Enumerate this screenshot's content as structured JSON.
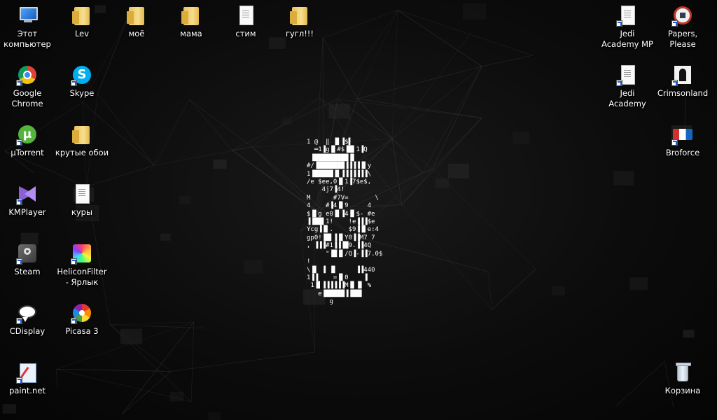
{
  "desktop": {
    "icons_left": [
      {
        "label": "Этот компьютер",
        "icon": "computer-icon"
      },
      {
        "label": "Google Chrome",
        "icon": "chrome-icon"
      },
      {
        "label": "µTorrent",
        "icon": "utorrent-icon"
      },
      {
        "label": "KMPlayer",
        "icon": "kmplayer-icon"
      },
      {
        "label": "Steam",
        "icon": "steam-icon"
      },
      {
        "label": "CDisplay",
        "icon": "cdisplay-icon"
      },
      {
        "label": "paint.net",
        "icon": "paintnet-icon"
      }
    ],
    "icons_col2": [
      {
        "label": "Lev",
        "icon": "user-folder-icon"
      },
      {
        "label": "Skype",
        "icon": "skype-icon"
      },
      {
        "label": "крутые обои",
        "icon": "folder-icon"
      },
      {
        "label": "куры",
        "icon": "document-icon"
      },
      {
        "label": "HeliconFilter - Ярлык",
        "icon": "heliconfilter-icon"
      },
      {
        "label": "Picasa 3",
        "icon": "picasa-icon"
      }
    ],
    "icons_top": [
      {
        "label": "моё",
        "icon": "folder-icon"
      },
      {
        "label": "мама",
        "icon": "folder-icon"
      },
      {
        "label": "стим",
        "icon": "document-icon"
      },
      {
        "label": "гугл!!!",
        "icon": "folder-icon"
      }
    ],
    "icons_right": [
      {
        "label": "Jedi Academy MP",
        "icon": "document-icon"
      },
      {
        "label": "Papers, Please",
        "icon": "papers-please-icon"
      },
      {
        "label": "Jedi Academy",
        "icon": "document-icon"
      },
      {
        "label": "Crimsonland",
        "icon": "crimsonland-icon"
      },
      {
        "label": "Broforce",
        "icon": "broforce-icon"
      },
      {
        "label": "Корзина",
        "icon": "recycle-bin-icon"
      }
    ]
  },
  "wallpaper": {
    "background_color": "#0b0b0b",
    "line_color": "#3a3a3a",
    "ascii_art_lines": [
      "1 @  ‖ ▐▌▐$▌",
      "  ═1▐g▐▌#$▐█▌1▐Q",
      " ▐█████████▐▌",
      "#/▐███████▐▐▐▐▐▌y",
      "1▐█████▐▌▐▐▐▐▐▐▐\\",
      "/e $ee,0▐▌1▐7$e$,",
      "    4j7▐4!",
      "M      #7V=       \\",
      "4    #▐4▐▌9     4",
      "$▐▌g e0▐▌▐4▐▌$- #e",
      "▐▐██▌1!    !e▐▐▐$e",
      "Ycg▐▐▌.    $9▐▐▌e:4",
      "gp0!▐█▌▐▐▌Y0▐▐M7 7",
      ", ▐▐▐#1▐▐▐█9.▐▐4Q",
      "     \"▐█▐▌/Q▐-▐▐7.0$",
      "!",
      "\\▐▌ ▐ ▐▌     ▐▐440",
      "1▐▐    =▐▌0    ▐",
      " 1▐▌▐▐▐▐▐▐M▐▌▐▌ %",
      "   e▐█████▐▐██▌",
      "      g"
    ]
  }
}
